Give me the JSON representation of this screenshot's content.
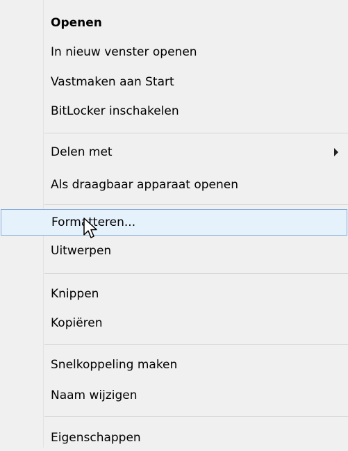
{
  "context_menu": {
    "items": [
      {
        "label": "Openen"
      },
      {
        "label": "In nieuw venster openen"
      },
      {
        "label": "Vastmaken aan Start"
      },
      {
        "label": "BitLocker inschakelen"
      },
      {
        "label": "Delen met"
      },
      {
        "label": "Als draagbaar apparaat openen"
      },
      {
        "label": "Formatteren..."
      },
      {
        "label": "Uitwerpen"
      },
      {
        "label": "Knippen"
      },
      {
        "label": "Kopiëren"
      },
      {
        "label": "Snelkoppeling maken"
      },
      {
        "label": "Naam wijzigen"
      },
      {
        "label": "Eigenschappen"
      }
    ],
    "default_item": "Openen",
    "highlighted_item": "Formatteren...",
    "submenu_items": [
      "Delen met"
    ],
    "icons": {
      "submenu": "chevron-right-icon",
      "cursor": "mouse-pointer-icon"
    },
    "colors": {
      "background": "#f0f0f0",
      "highlight_fill": "#e5f1fb",
      "highlight_border": "#84acdd",
      "separator": "#d7d7d7"
    }
  }
}
